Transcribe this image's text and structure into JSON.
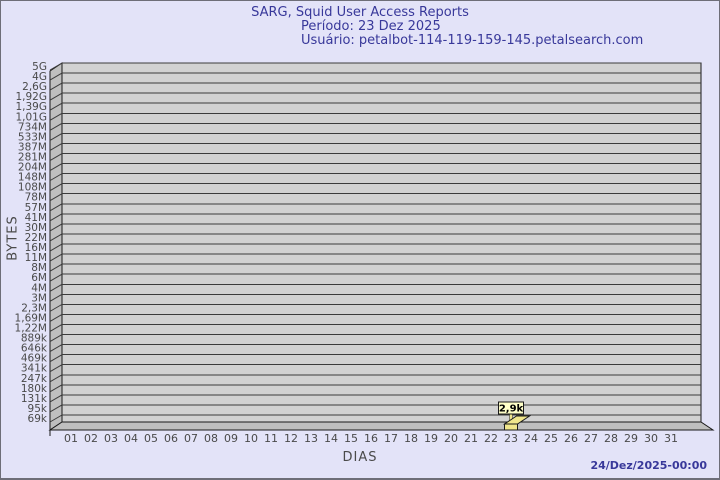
{
  "window": {
    "bg_color": "#e3e3f8",
    "border_color": "#6e6e78"
  },
  "header": {
    "title": "SARG, Squid User Access Reports",
    "period": "Período: 23 Dez 2025",
    "user": "Usuário: petalbot-114-119-159-145.petalsearch.com",
    "text_color": "#38389a"
  },
  "footer": {
    "timestamp": "24/Dez/2025-00:00",
    "text_color": "#38389a"
  },
  "chart_data": {
    "type": "bar",
    "style": "3d-extruded",
    "title": "SARG, Squid User Access Reports",
    "subtitle": "Período: 23 Dez 2025",
    "xlabel": "DIAS",
    "ylabel": "BYTES",
    "scale": "log",
    "grid": "horizontal",
    "x_categories": [
      "01",
      "02",
      "03",
      "04",
      "05",
      "06",
      "07",
      "08",
      "09",
      "10",
      "11",
      "12",
      "13",
      "14",
      "15",
      "16",
      "17",
      "18",
      "19",
      "20",
      "21",
      "22",
      "23",
      "24",
      "25",
      "26",
      "27",
      "28",
      "29",
      "30",
      "31"
    ],
    "y_tick_labels": [
      "5G",
      "4G",
      "2,6G",
      "1,92G",
      "1,39G",
      "1,01G",
      "734M",
      "533M",
      "387M",
      "281M",
      "204M",
      "148M",
      "108M",
      "78M",
      "57M",
      "41M",
      "30M",
      "22M",
      "16M",
      "11M",
      "8M",
      "6M",
      "4M",
      "3M",
      "2,3M",
      "1,69M",
      "1,22M",
      "889k",
      "646k",
      "469k",
      "341k",
      "247k",
      "180k",
      "131k",
      "95k",
      "69k"
    ],
    "bars": [
      {
        "day": "23",
        "label": "2,9k",
        "approx_bytes": 2900
      }
    ],
    "colors": {
      "plot_bg": "#d2d2d2",
      "wall": "#bfbfbf",
      "grid": "#3c3c3c",
      "frame": "#1a1a1a",
      "tick_text": "#4a4a4a",
      "bar_fill": "#f0e68c",
      "bar_label_bg": "#ffffc8",
      "bar_label_text": "#000000"
    }
  }
}
